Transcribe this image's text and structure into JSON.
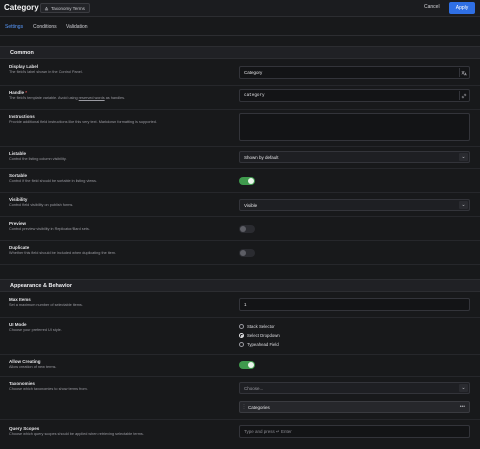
{
  "header": {
    "title": "Category",
    "badge": "Taxonomy Terms",
    "badge_icon": "taxonomy-icon",
    "cancel_label": "Cancel",
    "apply_label": "Apply",
    "accent": "#2f6fe4"
  },
  "tabs": [
    {
      "label": "Settings",
      "active": true
    },
    {
      "label": "Conditions",
      "active": false
    },
    {
      "label": "Validation",
      "active": false
    }
  ],
  "common": {
    "heading": "Common",
    "display_label": {
      "label": "Display Label",
      "desc": "The field's label shown in the Control Panel.",
      "value": "Category",
      "icon": "translate-icon"
    },
    "handle": {
      "label": "Handle",
      "required": "*",
      "desc_pre": "The field's template variable. Avoid using ",
      "desc_link": "reserved words",
      "desc_post": " as handles.",
      "value": "category",
      "icon": "link-icon"
    },
    "instructions": {
      "label": "Instructions",
      "desc": "Provide additional field instructions like this very text. Markdown formatting is supported.",
      "value": ""
    },
    "listable": {
      "label": "Listable",
      "desc": "Control the listing column visibility.",
      "value": "Shown by default"
    },
    "sortable": {
      "label": "Sortable",
      "desc": "Control if the field should be sortable in listing views.",
      "on": true
    },
    "visibility": {
      "label": "Visibility",
      "desc": "Control field visibility on publish forms.",
      "value": "Visible"
    },
    "preview": {
      "label": "Preview",
      "desc": "Control preview visibility in Replicator/Bard sets.",
      "on": false
    },
    "duplicate": {
      "label": "Duplicate",
      "desc": "Whether this field should be included when duplicating the item.",
      "on": false
    }
  },
  "appearance": {
    "heading": "Appearance & Behavior",
    "max_items": {
      "label": "Max Items",
      "desc": "Set a maximum number of selectable items.",
      "value": "1"
    },
    "ui_mode": {
      "label": "UI Mode",
      "desc": "Choose your preferred UI style.",
      "options": [
        {
          "label": "Stack Selector",
          "checked": false
        },
        {
          "label": "Select Dropdown",
          "checked": true
        },
        {
          "label": "Typeahead Field",
          "checked": false
        }
      ]
    },
    "allow_creating": {
      "label": "Allow Creating",
      "desc": "Allow creation of new terms.",
      "on": true
    },
    "taxonomies": {
      "label": "Taxonomies",
      "desc": "Choose which taxonomies to show terms from.",
      "placeholder": "Choose...",
      "selected": "Categories",
      "selected_more": "•••"
    },
    "query_scopes": {
      "label": "Query Scopes",
      "desc": "Choose which query scopes should be applied when retrieving selectable terms.",
      "placeholder": "Type and press ↵ Enter"
    }
  }
}
